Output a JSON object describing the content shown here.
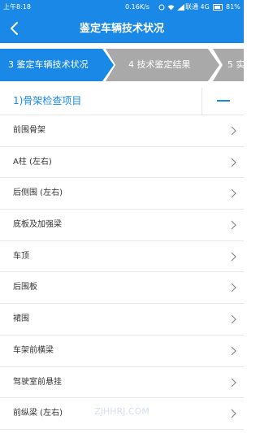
{
  "status_bar": {
    "time": "上午8:18",
    "speed": "0.16K/s",
    "carrier": "联通 4G",
    "battery": "81%"
  },
  "nav": {
    "title": "鉴定车辆技术状况"
  },
  "steps": [
    {
      "label": "3 鉴定车辆技术状况",
      "active": true
    },
    {
      "label": "4 技术鉴定结果",
      "active": false
    },
    {
      "label": "5 实",
      "active": false
    }
  ],
  "section": {
    "title": "1)骨架检查项目"
  },
  "items": [
    "前围骨架",
    "A柱 (左右)",
    "后侧围 (左右)",
    "底板及加强梁",
    "车顶",
    "后围板",
    "裙围",
    "车架前横梁",
    "驾驶室前悬挂",
    "前纵梁 (左右)"
  ],
  "watermark": "ZJHHRJ.COM",
  "colors": {
    "primary": "#1a88e6",
    "step_inactive": "#a9a9a9"
  }
}
